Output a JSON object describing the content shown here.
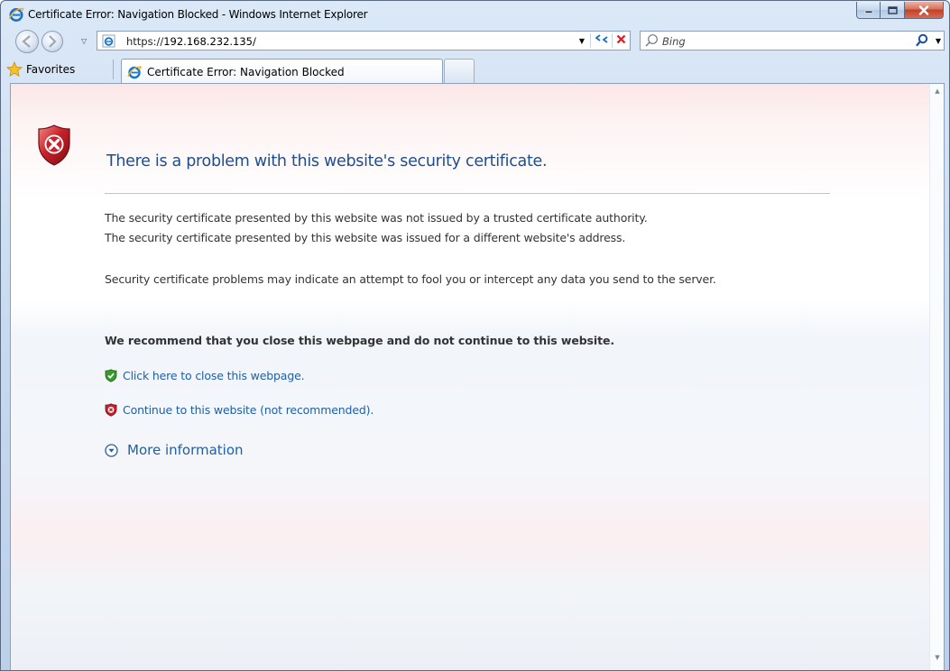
{
  "window": {
    "title": "Certificate Error: Navigation Blocked - Windows Internet Explorer"
  },
  "nav": {
    "url_prefix": "https://",
    "url_host": "192.168.232.135/",
    "search_placeholder": "Bing"
  },
  "favorites_bar": {
    "favorites_label": "Favorites",
    "tab_label": "Certificate Error: Navigation Blocked"
  },
  "page": {
    "heading": "There is a problem with this website's security certificate.",
    "lines": [
      "The security certificate presented by this website was not issued by a trusted certificate authority.",
      "The security certificate presented by this website was issued for a different website's address."
    ],
    "warning": "Security certificate problems may indicate an attempt to fool you or intercept any data you send to the server.",
    "recommendation": "We recommend that you close this webpage and do not continue to this website.",
    "close_link": "Click here to close this webpage.",
    "continue_link": "Continue to this website (not recommended).",
    "more_info": "More information"
  },
  "icons": {
    "error_shield": "shield-x-icon",
    "safe_shield": "shield-check-icon",
    "unsafe_shield": "shield-x-small-icon",
    "expand": "expand-circle-icon"
  },
  "colors": {
    "link": "#1f5fa8",
    "heading": "#1f4e8a",
    "error_red": "#c8212b",
    "safe_green": "#3a9a2a"
  }
}
